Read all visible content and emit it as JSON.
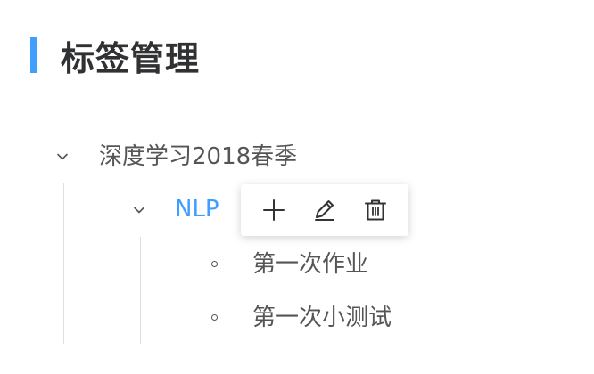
{
  "page": {
    "title": "标签管理",
    "accent_color": "#409EFF"
  },
  "tree": {
    "root": {
      "label": "深度学习2018春季",
      "expanded": true,
      "icon": "chevron-down-icon",
      "children": [
        {
          "label": "NLP",
          "expanded": true,
          "active": true,
          "active_color": "#409EFF",
          "icon": "chevron-down-icon",
          "children": [
            {
              "label": "第一次作业",
              "icon": "circle-bullet-icon"
            },
            {
              "label": "第一次小测试",
              "icon": "circle-bullet-icon"
            }
          ]
        }
      ]
    }
  },
  "actions": [
    {
      "name": "add",
      "icon": "plus-icon"
    },
    {
      "name": "edit",
      "icon": "pencil-icon"
    },
    {
      "name": "delete",
      "icon": "trash-icon"
    }
  ]
}
